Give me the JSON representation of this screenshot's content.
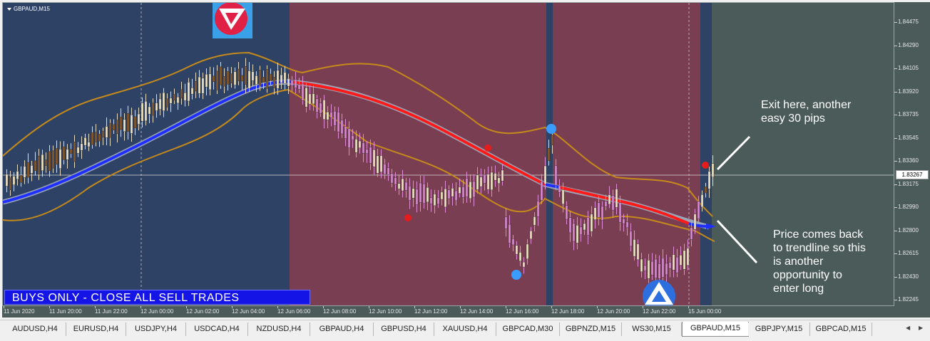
{
  "window": {
    "symbol_title": "GBPAUD,M15"
  },
  "banner": {
    "text": "BUYS ONLY - CLOSE ALL SELL TRADES"
  },
  "annotations": {
    "exit_note": [
      "Exit here, another",
      "easy 30 pips"
    ],
    "reentry_note": [
      "Price comes back",
      "to trendline so this",
      "is another",
      "opportunity to",
      "enter long"
    ]
  },
  "price_scale": {
    "labels": [
      "1.84475",
      "1.84290",
      "1.84105",
      "1.83920",
      "1.83735",
      "1.83545",
      "1.83360",
      "1.83175",
      "1.82990",
      "1.82800",
      "1.82615",
      "1.82430",
      "1.82245"
    ],
    "current_price": "1.83267"
  },
  "time_axis": {
    "labels": [
      "11 Jun 2020",
      "11 Jun 20:00",
      "11 Jun 22:00",
      "12 Jun 00:00",
      "12 Jun 02:00",
      "12 Jun 04:00",
      "12 Jun 06:00",
      "12 Jun 08:00",
      "12 Jun 10:00",
      "12 Jun 12:00",
      "12 Jun 14:00",
      "12 Jun 16:00",
      "12 Jun 18:00",
      "12 Jun 20:00",
      "12 Jun 22:00",
      "15 Jun 00:00"
    ]
  },
  "tabs": {
    "items": [
      "AUDUSD,H4",
      "EURUSD,H4",
      "USDJPY,H4",
      "USDCAD,H4",
      "NZDUSD,H4",
      "GBPAUD,H4",
      "GBPUSD,H4",
      "XAUUSD,H4",
      "GBPCAD,M30",
      "GBPNZD,M15",
      "WS30,M15",
      "GBPAUD,M15",
      "GBPJPY,M15",
      "GBPCAD,M15"
    ],
    "active_index": 11
  },
  "colors": {
    "background": "#4a5b5a",
    "buy_zone": "#2e4266",
    "sell_zone": "#7a3e52",
    "trend_up": "#1f2fff",
    "trend_down": "#ff1a1a",
    "bands": "#c58a1a",
    "bull_candle": "#f3e8c8",
    "bear_candle_up_zone": "#8b5a2b",
    "bear_candle_down_zone": "#e08ad8",
    "banner": "#1414e6"
  },
  "icons": [
    "sell-arrow-icon",
    "buy-arrow-icon",
    "signal-dot-icon",
    "dropdown-arrow-icon"
  ]
}
